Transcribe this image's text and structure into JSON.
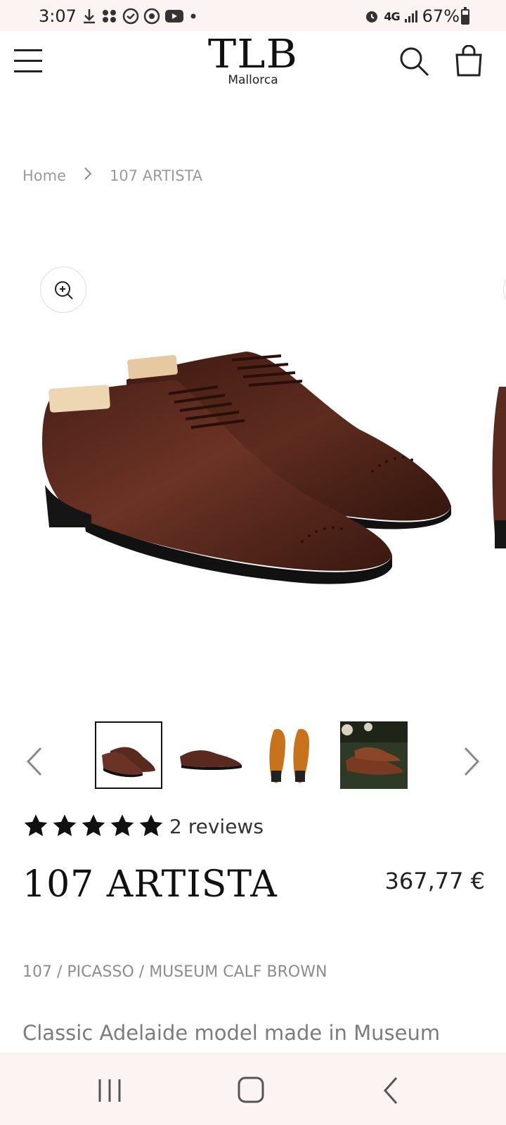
{
  "status": {
    "time": "3:07",
    "network": "4G",
    "battery": "67%",
    "battery_level": 0.67
  },
  "header": {
    "brand": "TLB",
    "brand_sub": "Mallorca"
  },
  "breadcrumb": {
    "home": "Home",
    "current": "107 ARTISTA"
  },
  "gallery": {
    "thumbnail_count": 4,
    "active_thumbnail": 1
  },
  "product": {
    "rating": 5,
    "reviews": "2 reviews",
    "title": "107 ARTISTA",
    "price": "367,77 €",
    "variant": "107 / PICASSO / MUSEUM CALF BROWN",
    "description": "Classic Adelaide model made in Museum"
  },
  "colors": {
    "status_bg": "#fbf4f2",
    "leather": "#5a2a1f",
    "sole": "#111111"
  },
  "icons": [
    "menu-icon",
    "search-icon",
    "bag-icon",
    "zoom-in-icon",
    "chevron-left-icon",
    "chevron-right-icon",
    "star-icon",
    "recents-icon",
    "home-icon",
    "back-icon"
  ]
}
